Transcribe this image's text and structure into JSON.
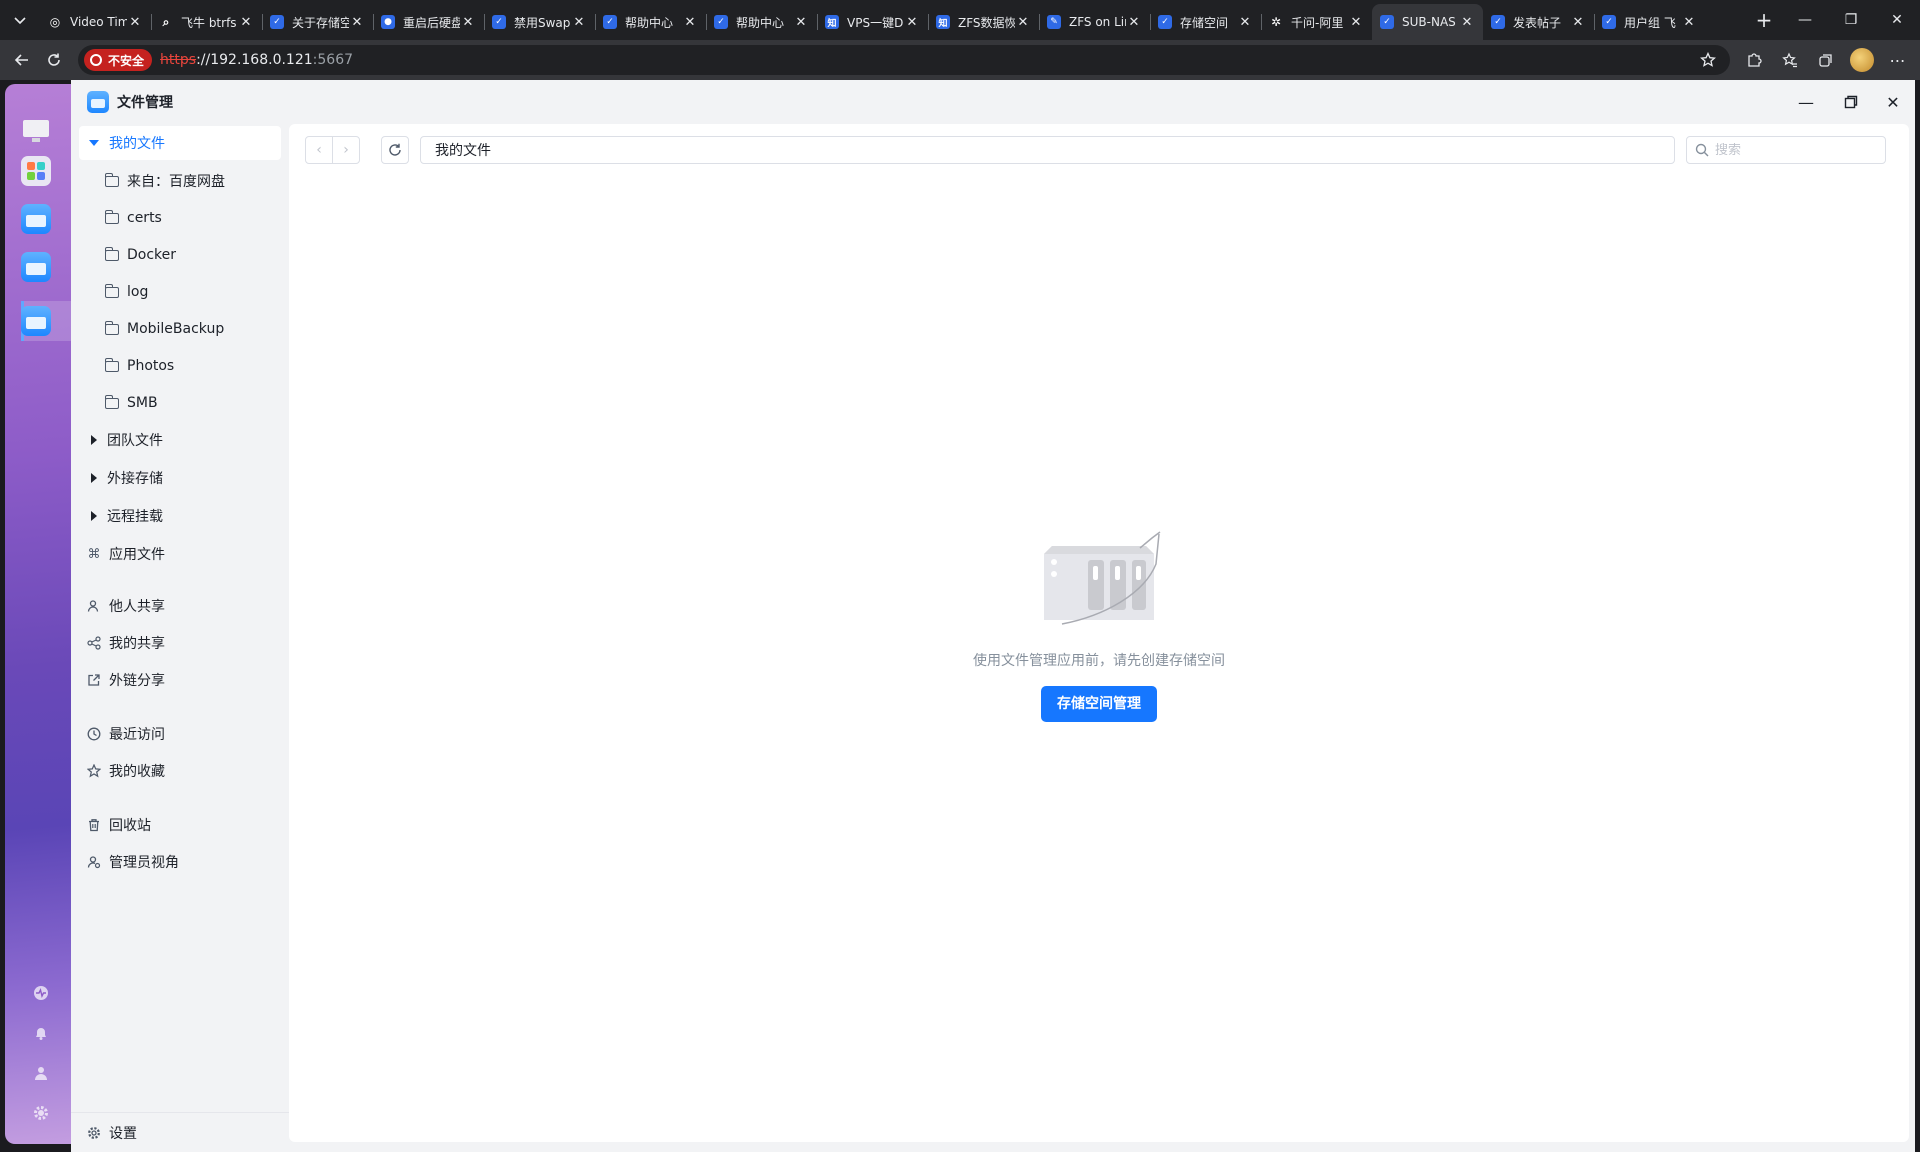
{
  "browser": {
    "tabs": [
      {
        "title": "Video Tim",
        "favicon": "globe-icon"
      },
      {
        "title": "飞牛 btrfs",
        "favicon": "search-icon"
      },
      {
        "title": "关于存储空",
        "favicon": "fnos-icon"
      },
      {
        "title": "重启后硬盘",
        "favicon": "chrome-icon"
      },
      {
        "title": "禁用Swap",
        "favicon": "fnos-icon"
      },
      {
        "title": "帮助中心",
        "favicon": "fnos-icon"
      },
      {
        "title": "帮助中心",
        "favicon": "fnos-icon"
      },
      {
        "title": "VPS一键D",
        "favicon": "zhihu-icon"
      },
      {
        "title": "ZFS数据恢",
        "favicon": "zhihu-icon"
      },
      {
        "title": "ZFS on Lin",
        "favicon": "pen-icon"
      },
      {
        "title": "存储空间",
        "favicon": "fnos-icon"
      },
      {
        "title": "千问-阿里",
        "favicon": "qwen-icon"
      },
      {
        "title": "SUB-NAS",
        "favicon": "fnos-icon",
        "active": true
      },
      {
        "title": "发表帖子",
        "favicon": "fnos-icon"
      },
      {
        "title": "用户组 飞",
        "favicon": "fnos-icon"
      }
    ],
    "security_label": "不安全",
    "url_scheme": "https",
    "url_sep": "://",
    "url_host": "192.168.0.121",
    "url_port": ":5667"
  },
  "app": {
    "title": "文件管理"
  },
  "sidebar": {
    "my_files": "我的文件",
    "folders": [
      "来自：百度网盘",
      "certs",
      "Docker",
      "log",
      "MobileBackup",
      "Photos",
      "SMB"
    ],
    "team_files": "团队文件",
    "external_storage": "外接存储",
    "remote_mount": "远程挂载",
    "app_files": "应用文件",
    "shared_with_me": "他人共享",
    "my_shares": "我的共享",
    "link_shares": "外链分享",
    "recent": "最近访问",
    "favorites": "我的收藏",
    "recycle_bin": "回收站",
    "admin_view": "管理员视角",
    "settings": "设置"
  },
  "main": {
    "path": "我的文件",
    "search_placeholder": "搜索",
    "empty_message": "使用文件管理应用前，请先创建存储空间",
    "manage_storage_button": "存储空间管理"
  },
  "colors": {
    "accent": "#1677ff",
    "insecure_badge": "#c5221f"
  }
}
